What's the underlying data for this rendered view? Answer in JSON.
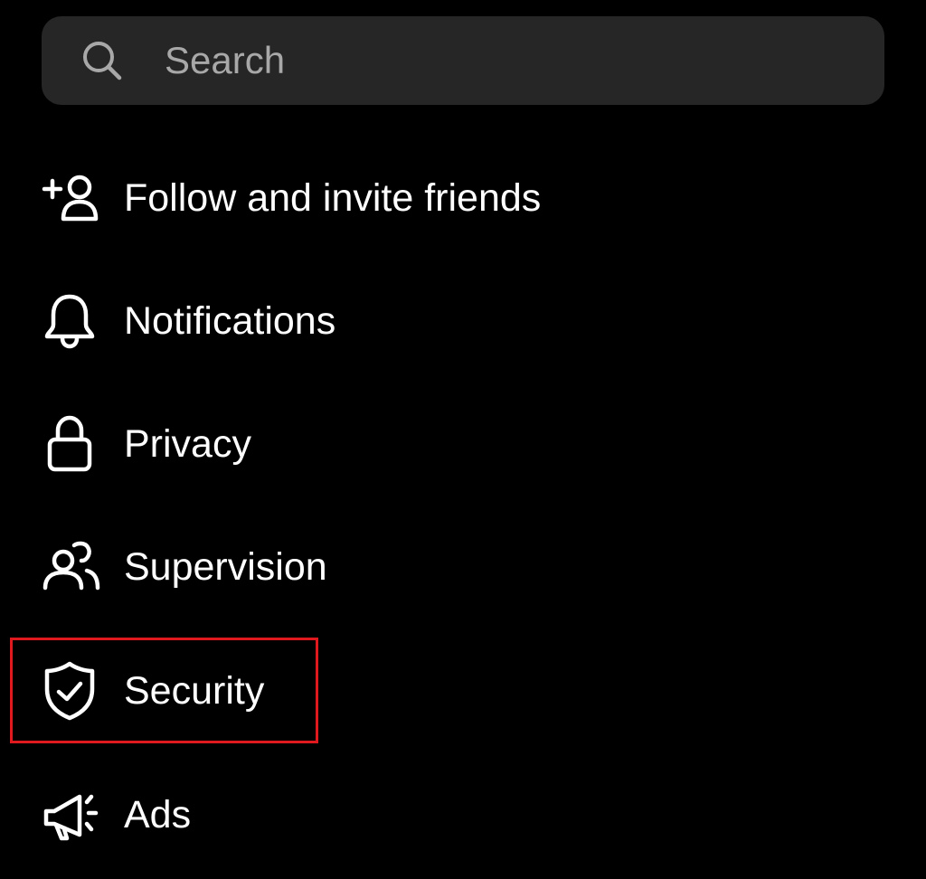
{
  "search": {
    "placeholder": "Search",
    "icon": "search-icon"
  },
  "menu": {
    "items": [
      {
        "id": "follow",
        "label": "Follow and invite friends",
        "icon": "add-person-icon"
      },
      {
        "id": "notifications",
        "label": "Notifications",
        "icon": "bell-icon"
      },
      {
        "id": "privacy",
        "label": "Privacy",
        "icon": "lock-icon"
      },
      {
        "id": "supervision",
        "label": "Supervision",
        "icon": "people-icon"
      },
      {
        "id": "security",
        "label": "Security",
        "icon": "shield-check-icon",
        "highlighted": true
      },
      {
        "id": "ads",
        "label": "Ads",
        "icon": "megaphone-icon"
      }
    ]
  },
  "colors": {
    "background": "#000000",
    "search_background": "#262626",
    "placeholder": "#a8a8a8",
    "text": "#ffffff",
    "highlight": "#e0191f"
  }
}
